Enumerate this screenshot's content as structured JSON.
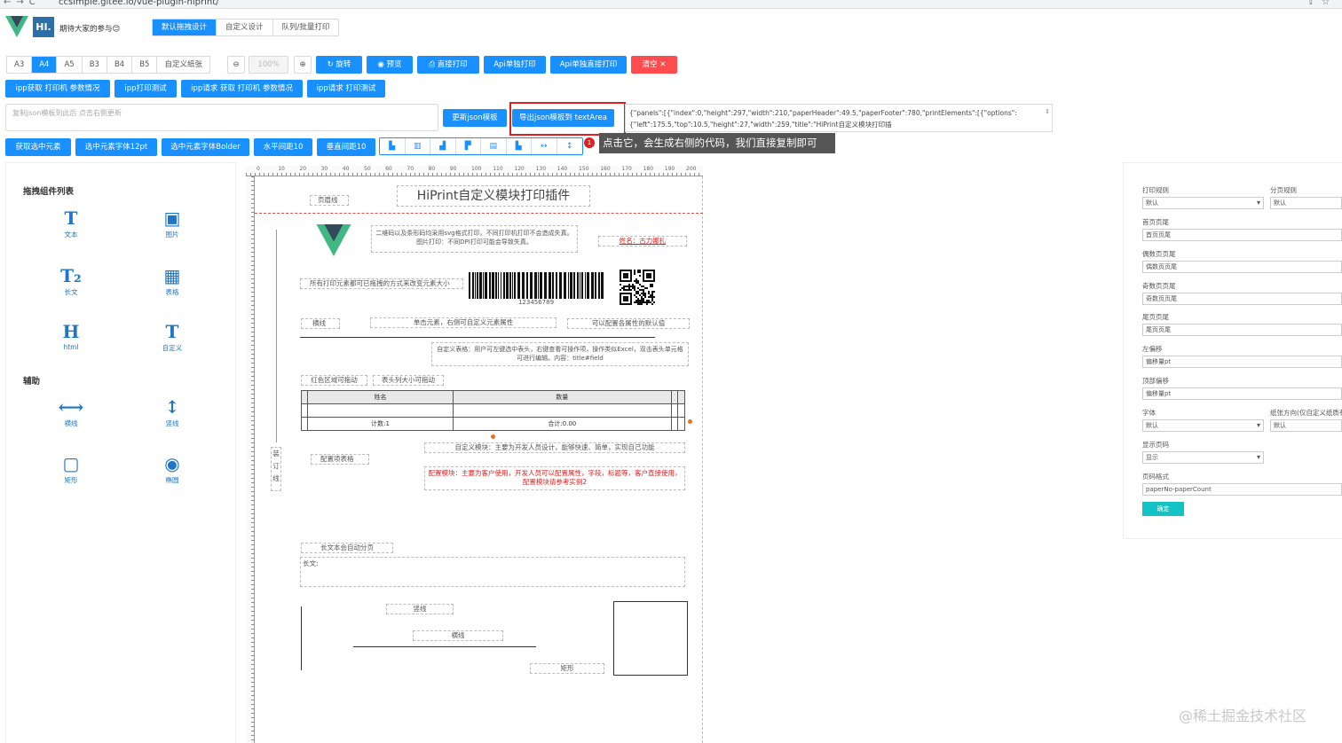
{
  "browser": {
    "url": "ccsimple.gitee.io/vue-plugin-hiprint/"
  },
  "header": {
    "logo_text": "HI.",
    "slogan": "期待大家的参与😊",
    "tabs": [
      {
        "label": "默认拖拽设计",
        "active": true
      },
      {
        "label": "自定义设计",
        "active": false
      },
      {
        "label": "队列/批量打印",
        "active": false
      }
    ]
  },
  "toolbar1": {
    "paper_sizes": [
      "A3",
      "A4",
      "A5",
      "B3",
      "B4",
      "B5",
      "自定义纸张"
    ],
    "active_paper": "A4",
    "zoom_out_icon": "zoom-out-icon",
    "zoom_value": "100%",
    "zoom_in_icon": "zoom-in-icon",
    "rotate": "旋转",
    "preview": "预览",
    "direct_print": "直接打印",
    "api_print": "Api单独打印",
    "api_direct_print": "Api单独直接打印",
    "clear": "清空"
  },
  "toolbar2": {
    "ipp_get_printers": "ipp获取 打印机 参数情况",
    "ipp_test": "ipp打印测试",
    "ipp_request_printers": "ipp请求 获取 打印机 参数情况",
    "ipp_request_test": "ipp请求 打印测试"
  },
  "json_row": {
    "placeholder": "复制json模板到此后 点击右侧更新",
    "update_btn": "更新json模板",
    "export_btn": "导出json模板到 textArea",
    "output_line1": "{\"panels\":[{\"index\":0,\"height\":297,\"width\":210,\"paperHeader\":49.5,\"paperFooter\":780,\"printElements\":[{\"options\":",
    "output_line2": "{\"left\":175.5,\"top\":10.5,\"height\":27,\"width\":259,\"title\":\"HiPrint自定义模块打印插",
    "badge": "1",
    "tooltip": "点击它，会生成右侧的代码，我们直接复制即可"
  },
  "toolbar3": {
    "get_selected": "获取选中元素",
    "font_12pt": "选中元素字体12pt",
    "font_bolder": "选中元素字体Bolder",
    "hspace_10": "水平间距10",
    "vspace_10": "垂直间距10"
  },
  "left_panel": {
    "title": "拖拽组件列表",
    "components": [
      {
        "label": "文本",
        "glyph": "T",
        "icon": "text-icon"
      },
      {
        "label": "图片",
        "glyph": "▣",
        "icon": "image-icon"
      },
      {
        "label": "长文",
        "glyph": "T₂",
        "icon": "longtext-icon"
      },
      {
        "label": "表格",
        "glyph": "▦",
        "icon": "table-icon"
      },
      {
        "label": "html",
        "glyph": "H",
        "icon": "html-icon"
      },
      {
        "label": "自定义",
        "glyph": "T",
        "icon": "custom-icon"
      }
    ],
    "aux_title": "辅助",
    "aux": [
      {
        "label": "横线",
        "glyph": "⟷",
        "icon": "hline-icon"
      },
      {
        "label": "竖线",
        "glyph": "↕",
        "icon": "vline-icon"
      },
      {
        "label": "矩形",
        "glyph": "▢",
        "icon": "rect-icon"
      },
      {
        "label": "椭圆",
        "glyph": "◉",
        "icon": "ellipse-icon"
      }
    ]
  },
  "canvas": {
    "ruler_labels": [
      "0",
      "10",
      "20",
      "30",
      "40",
      "50",
      "60",
      "70",
      "80",
      "90",
      "100",
      "110",
      "120",
      "130",
      "140",
      "150",
      "160",
      "170",
      "180",
      "190",
      "200"
    ],
    "title": "HiPrint自定义模块打印插件",
    "header_line": "页眉线",
    "svg_note": "二维码以及条形码均采用svg格式打印。不同打印机打印不会造成失真。图片打印：不同DPI打印可能会导致失真。",
    "name_field": "姓名：古力娜扎",
    "resize_note": "所有打印元素都可已拖拽的方式来改变元素大小",
    "barcode_value": "123456789",
    "hline_label": "横线",
    "click_note": "单击元素，右侧可自定义元素属性",
    "default_note": "可以配置各属性的默认值",
    "table_note": "自定义表格：用户可左键选中表头，右键查看可操作项，操作类似Excel，双击表头单元格可进行编辑。内容：title#field",
    "red_drag": "红色区域可拖动",
    "col_resize": "表头列大小可拖动",
    "table_headers": [
      "",
      "姓名",
      "数量",
      "",
      ""
    ],
    "table_footer": [
      "",
      "计数:1",
      "合计:0.00",
      "",
      ""
    ],
    "binding": "装订线",
    "custom_module": "自定义模块：主要为开发人员设计，能够快速、简单，实现自己功能",
    "config_table": "配置项表格",
    "config_module": "配置模块：主要为客户使用，开发人员可以配置属性，字段，标题等，客户直接使用，配置模块请参考实例2",
    "longtext_paging": "长文本会自动分页",
    "longtext_label": "长文:",
    "vline": "竖线",
    "hline2": "横线",
    "rect": "矩形"
  },
  "right_panel": {
    "print_rule_label": "打印规则",
    "print_rule_value": "默认",
    "page_rule_label": "分页规则",
    "page_rule_value": "默认",
    "first_footer_label": "首页页尾",
    "first_footer_value": "首页页尾",
    "even_footer_label": "偶数页页尾",
    "even_footer_value": "偶数页页尾",
    "odd_footer_label": "奇数页页尾",
    "odd_footer_value": "奇数页页尾",
    "last_footer_label": "尾页页尾",
    "last_footer_value": "尾页页尾",
    "left_offset_label": "左偏移",
    "left_offset_value": "偏移量pt",
    "top_offset_label": "顶部偏移",
    "top_offset_value": "偏移量pt",
    "font_label": "字体",
    "font_value": "默认",
    "paper_dir_label": "纸张方向(仅自定义纸质有效)",
    "paper_dir_value": "默认",
    "show_page_label": "显示页码",
    "show_page_value": "显示",
    "page_format_label": "页码格式",
    "page_format_value": "paperNo-paperCount",
    "confirm": "确定"
  },
  "watermark": "@稀土掘金技术社区",
  "colors": {
    "primary": "#1890ff",
    "danger": "#ff4d4f",
    "teal": "#13c2c2",
    "logo_green": "#41b883",
    "logo_dark": "#35495e"
  }
}
